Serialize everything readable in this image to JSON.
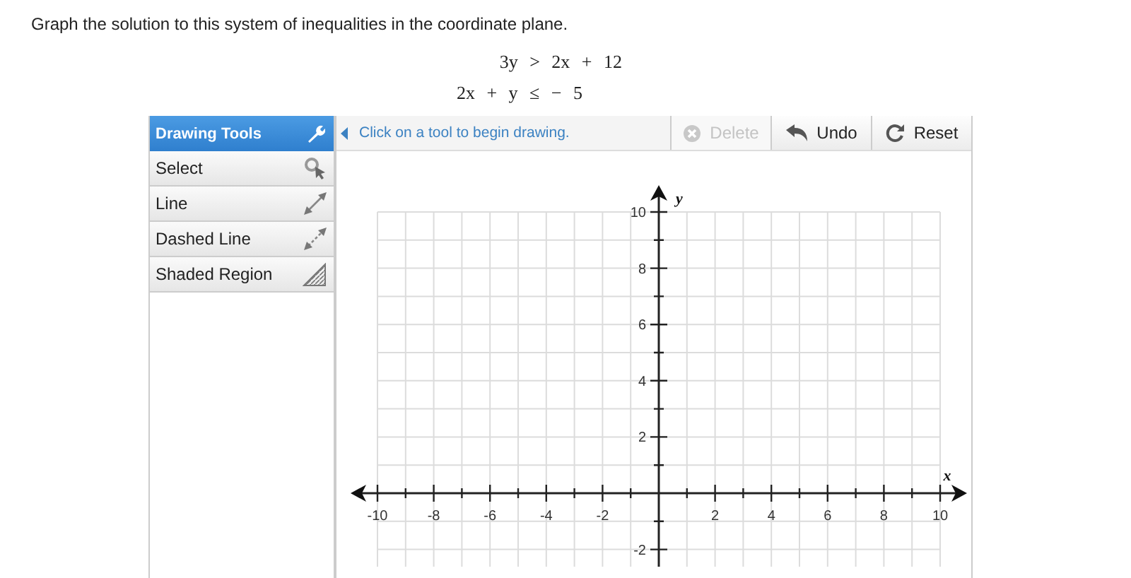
{
  "question": {
    "prompt": "Graph the solution to this system of inequalities in the coordinate plane.",
    "inequalities": [
      "3y > 2x + 12",
      "2x + y ≤ − 5"
    ]
  },
  "tool_panel": {
    "title": "Drawing Tools",
    "tools": [
      {
        "label": "Select",
        "kind": "select"
      },
      {
        "label": "Line",
        "kind": "line"
      },
      {
        "label": "Dashed Line",
        "kind": "dashed_line"
      },
      {
        "label": "Shaded Region",
        "kind": "shaded_region"
      }
    ]
  },
  "toolbar": {
    "message": "Click on a tool to begin drawing.",
    "buttons": [
      {
        "label": "Delete",
        "kind": "delete",
        "disabled": true
      },
      {
        "label": "Undo",
        "kind": "undo",
        "disabled": false
      },
      {
        "label": "Reset",
        "kind": "reset",
        "disabled": false
      }
    ]
  },
  "graph": {
    "chart_data": {
      "type": "scatter",
      "grid": true,
      "xlabel": "x",
      "ylabel": "y",
      "xlim": [
        -10,
        10
      ],
      "ylim": [
        -2,
        10
      ],
      "xticks": [
        -10,
        -8,
        -6,
        -4,
        -2,
        2,
        4,
        6,
        8,
        10
      ],
      "yticks": [
        -2,
        2,
        4,
        6,
        8,
        10
      ]
    }
  }
}
